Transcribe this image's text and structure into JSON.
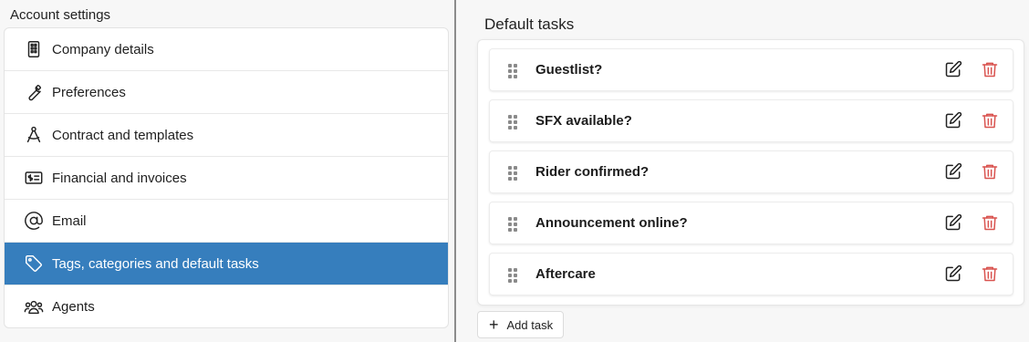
{
  "sidebar": {
    "title": "Account settings",
    "items": [
      {
        "label": "Company details",
        "icon": "building-icon",
        "active": false
      },
      {
        "label": "Preferences",
        "icon": "wrench-icon",
        "active": false
      },
      {
        "label": "Contract and templates",
        "icon": "compass-icon",
        "active": false
      },
      {
        "label": "Financial and invoices",
        "icon": "money-card-icon",
        "active": false
      },
      {
        "label": "Email",
        "icon": "at-sign-icon",
        "active": false
      },
      {
        "label": "Tags, categories and default tasks",
        "icon": "tag-icon",
        "active": true
      },
      {
        "label": "Agents",
        "icon": "users-icon",
        "active": false
      }
    ]
  },
  "main": {
    "title": "Default tasks",
    "tasks": [
      {
        "label": "Guestlist?"
      },
      {
        "label": "SFX available?"
      },
      {
        "label": "Rider confirmed?"
      },
      {
        "label": "Announcement online?"
      },
      {
        "label": "Aftercare"
      }
    ],
    "add_task_label": "Add task"
  },
  "colors": {
    "active_bg": "#367ebd",
    "delete": "#d9534f",
    "page_bg": "#f7f7f7"
  }
}
